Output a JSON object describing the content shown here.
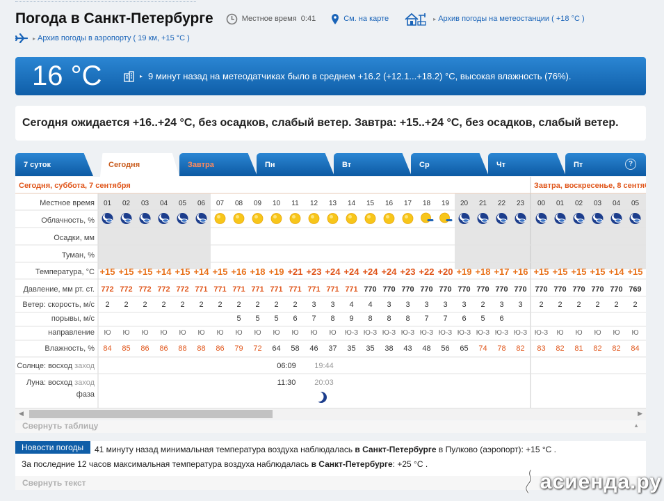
{
  "header": {
    "title": "Погода в Санкт-Петербурге",
    "local_time_label": "Местное время",
    "local_time": "0:41",
    "map_link": "См. на карте",
    "archive_station": "Архив погоды на метеостанции ( +18 °C )",
    "archive_airport": "Архив погоды в аэропорту ( 19 км, +15 °C )"
  },
  "now": {
    "temperature": "16 °C",
    "description": "9 минут назад на метеодатчиках было в среднем +16.2 (+12.1...+18.2) °C, высокая влажность (76%)."
  },
  "forecast_text": "Сегодня ожидается +16..+24 °C, без осадков, слабый ветер. Завтра: +15..+24 °C, без осадков, слабый ветер.",
  "tabs": [
    "7 суток",
    "Сегодня",
    "Завтра",
    "Пн",
    "Вт",
    "Ср",
    "Чт",
    "Пт"
  ],
  "help_label": "?",
  "table": {
    "today_header": "Сегодня, суббота, 7 сентября",
    "tomorrow_header": "Завтра, воскресенье, 8 сентября",
    "labels": {
      "time": "Местное время",
      "cloud": "Облачность, %",
      "precip": "Осадки, мм",
      "fog": "Туман, %",
      "temp": "Температура, °C",
      "pressure": "Давление, мм рт. ст.",
      "wind_speed": "Ветер: скорость, м/с",
      "gusts": "порывы, м/с",
      "direction": "направление",
      "humidity": "Влажность, %",
      "sun_a": "Солнце:",
      "sun_b": "восход",
      "sun_c": "заход",
      "moon_a": "Луна:",
      "moon_b": "восход",
      "moon_c": "заход",
      "moon_phase": "фаза"
    },
    "hours": [
      "01",
      "02",
      "03",
      "04",
      "05",
      "06",
      "07",
      "08",
      "09",
      "10",
      "11",
      "12",
      "13",
      "14",
      "15",
      "16",
      "17",
      "18",
      "19",
      "20",
      "21",
      "22",
      "23",
      "00",
      "01",
      "02",
      "03",
      "04",
      "05"
    ],
    "cloud_icons": [
      "moon-cloud",
      "moon-cloud",
      "moon-cloud",
      "moon-cloud",
      "moon-cloud",
      "moon-cloud",
      "sun",
      "sun",
      "sun",
      "sun",
      "sun",
      "sun",
      "sun",
      "sun",
      "sun",
      "sun",
      "sun",
      "sun-cloud",
      "sun-cloud",
      "moon-cloud",
      "moon-cloud",
      "moon-cloud",
      "moon-cloud",
      "moon-cloud",
      "moon-cloud",
      "moon-cloud",
      "moon-cloud",
      "moon-cloud",
      "moon-cloud"
    ],
    "temperature": [
      "+15",
      "+15",
      "+15",
      "+14",
      "+15",
      "+14",
      "+15",
      "+16",
      "+18",
      "+19",
      "+21",
      "+23",
      "+24",
      "+24",
      "+24",
      "+24",
      "+23",
      "+22",
      "+20",
      "+19",
      "+18",
      "+17",
      "+16",
      "+15",
      "+15",
      "+15",
      "+15",
      "+14",
      "+15"
    ],
    "pressure": [
      "772",
      "772",
      "772",
      "772",
      "772",
      "771",
      "771",
      "771",
      "771",
      "771",
      "771",
      "771",
      "771",
      "771",
      "770",
      "770",
      "770",
      "770",
      "770",
      "770",
      "770",
      "770",
      "770",
      "770",
      "770",
      "770",
      "770",
      "770",
      "769"
    ],
    "wind_speed": [
      "2",
      "2",
      "2",
      "2",
      "2",
      "2",
      "2",
      "2",
      "2",
      "2",
      "2",
      "3",
      "3",
      "4",
      "4",
      "3",
      "3",
      "3",
      "3",
      "3",
      "2",
      "3",
      "3",
      "2",
      "2",
      "2",
      "2",
      "2",
      "2"
    ],
    "gusts": [
      "",
      "",
      "",
      "",
      "",
      "",
      "",
      "5",
      "5",
      "5",
      "6",
      "7",
      "8",
      "9",
      "8",
      "8",
      "8",
      "7",
      "7",
      "6",
      "5",
      "6",
      "",
      "",
      "",
      "",
      "",
      "",
      ""
    ],
    "direction": [
      "Ю",
      "Ю",
      "Ю",
      "Ю",
      "Ю",
      "Ю",
      "Ю",
      "Ю",
      "Ю",
      "Ю",
      "Ю",
      "Ю",
      "Ю",
      "Ю-З",
      "Ю-З",
      "Ю-З",
      "Ю-З",
      "Ю-З",
      "Ю-З",
      "Ю-З",
      "Ю-З",
      "Ю-З",
      "Ю-З",
      "Ю-З",
      "Ю",
      "Ю",
      "Ю",
      "Ю",
      "Ю"
    ],
    "humidity": [
      "84",
      "85",
      "86",
      "86",
      "88",
      "88",
      "86",
      "79",
      "72",
      "64",
      "58",
      "46",
      "37",
      "35",
      "35",
      "38",
      "43",
      "48",
      "56",
      "65",
      "74",
      "78",
      "82",
      "83",
      "82",
      "81",
      "82",
      "82",
      "84"
    ],
    "sunrise": "06:09",
    "sunset": "19:44",
    "moonrise": "11:30",
    "moonset": "20:03"
  },
  "collapse_table": "Свернуть таблицу",
  "news": {
    "badge": "Новости погоды",
    "line1_a": "41 минуту назад минимальная температура воздуха наблюдалась ",
    "line1_b": "в Санкт-Петербурге",
    "line1_c": " в Пулково (аэропорт): +15 °C .",
    "line2_a": "За последние 12 часов максимальная температура воздуха наблюдалась ",
    "line2_b": "в Санкт-Петербурге",
    "line2_c": ": +25 °C ."
  },
  "collapse_text": "Свернуть текст",
  "watermark": "асиенда.ру",
  "colors": {
    "accent": "#0f5ea8",
    "orange": "#e0561b",
    "link": "#1a64b8"
  }
}
